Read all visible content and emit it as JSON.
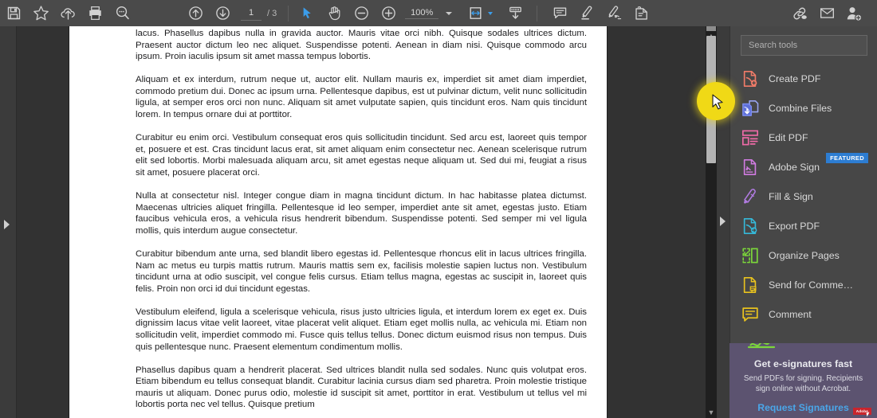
{
  "toolbar": {
    "left_tools": [
      {
        "name": "save-icon",
        "label": "Save"
      },
      {
        "name": "star-icon",
        "label": "Add to favorites"
      },
      {
        "name": "upload-cloud-icon",
        "label": "Upload to cloud"
      },
      {
        "name": "print-icon",
        "label": "Print file"
      },
      {
        "name": "search-icon",
        "label": "Find"
      }
    ],
    "nav_tools": [
      {
        "name": "previous-page-icon",
        "label": "Previous page"
      },
      {
        "name": "next-page-icon",
        "label": "Next page"
      }
    ],
    "page_current": "1",
    "page_separator": "/",
    "page_total": "3",
    "view_tools": [
      {
        "name": "select-cursor-icon",
        "label": "Select tool"
      },
      {
        "name": "hand-tool-icon",
        "label": "Hand tool"
      },
      {
        "name": "zoom-out-icon",
        "label": "Zoom out"
      },
      {
        "name": "zoom-in-icon",
        "label": "Zoom in"
      }
    ],
    "zoom_value": "100%",
    "fit_tools": [
      {
        "name": "fit-page-icon",
        "label": "Fit page"
      },
      {
        "name": "scroll-mode-icon",
        "label": "Page display"
      }
    ],
    "annot_tools": [
      {
        "name": "add-comment-icon",
        "label": "Add comment"
      },
      {
        "name": "highlight-text-icon",
        "label": "Highlight text"
      },
      {
        "name": "draw-freehand-icon",
        "label": "Draw free form"
      },
      {
        "name": "add-stamp-icon",
        "label": "Add stamp"
      }
    ],
    "share_tools": [
      {
        "name": "share-link-icon",
        "label": "Share a link"
      },
      {
        "name": "email-icon",
        "label": "Send by email"
      },
      {
        "name": "add-person-icon",
        "label": "Share with others"
      }
    ]
  },
  "search": {
    "placeholder": "Search tools",
    "value": ""
  },
  "tools": [
    {
      "label": "Create PDF",
      "icon": "create-pdf-icon",
      "color": "#f07b68"
    },
    {
      "label": "Combine Files",
      "icon": "combine-files-icon",
      "color": "#7b8cf0"
    },
    {
      "label": "Edit PDF",
      "icon": "edit-pdf-icon",
      "color": "#f06ba8"
    },
    {
      "label": "Adobe Sign",
      "icon": "adobe-sign-icon",
      "color": "#d07be0",
      "badge": "FEATURED"
    },
    {
      "label": "Fill & Sign",
      "icon": "fill-and-sign-icon",
      "color": "#b07be0"
    },
    {
      "label": "Export PDF",
      "icon": "export-pdf-icon",
      "color": "#35b8d8"
    },
    {
      "label": "Organize Pages",
      "icon": "organize-pages-icon",
      "color": "#7cd83a"
    },
    {
      "label": "Send for Comme…",
      "icon": "send-for-comments-icon",
      "color": "#e8c21e"
    },
    {
      "label": "Comment",
      "icon": "comment-icon",
      "color": "#e8c21e"
    }
  ],
  "promo": {
    "title": "Get e-signatures fast",
    "subtitle": "Send PDFs for signing. Recipients sign online without Acrobat.",
    "cta": "Request Signatures",
    "logo": "Adobe"
  },
  "document": {
    "paragraphs": [
      "lacus. Phasellus dapibus nulla in gravida auctor. Mauris vitae orci nibh. Quisque sodales ultrices dictum. Praesent auctor dictum leo nec aliquet. Suspendisse potenti. Aenean in diam nisi. Quisque commodo arcu ipsum. Proin iaculis ipsum sit amet massa tempus lobortis.",
      "Aliquam et ex interdum, rutrum neque ut, auctor elit. Nullam mauris ex, imperdiet sit amet diam imperdiet, commodo pretium dui. Donec ac ipsum urna. Pellentesque dapibus, est ut pulvinar dictum, velit nunc sollicitudin ligula, at semper eros orci non nunc. Aliquam sit amet vulputate sapien, quis tincidunt eros. Nam quis tincidunt lorem. In tempus ornare dui at porttitor.",
      "Curabitur eu enim orci. Vestibulum consequat eros quis sollicitudin tincidunt. Sed arcu est, laoreet quis tempor et, posuere et est. Cras tincidunt lacus erat, sit amet aliquam enim consectetur nec. Aenean scelerisque rutrum elit sed lobortis. Morbi malesuada aliquam arcu, sit amet egestas neque aliquam ut. Sed dui mi, feugiat a risus sit amet, posuere placerat orci.",
      "Nulla at consectetur nisl. Integer congue diam in magna tincidunt dictum. In hac habitasse platea dictumst. Maecenas ultricies aliquet fringilla. Pellentesque id leo semper, imperdiet ante sit amet, egestas justo. Etiam faucibus vehicula eros, a vehicula risus hendrerit bibendum. Suspendisse potenti. Sed semper mi vel ligula mollis, quis interdum augue consectetur.",
      "Curabitur bibendum ante urna, sed blandit libero egestas id. Pellentesque rhoncus elit in lacus ultrices fringilla. Nam ac metus eu turpis mattis rutrum. Mauris mattis sem ex, facilisis molestie sapien luctus non. Vestibulum tincidunt urna at odio suscipit, vel congue felis cursus. Etiam tellus magna, egestas ac suscipit in, laoreet quis felis. Proin non orci id dui tincidunt egestas.",
      "Vestibulum eleifend, ligula a scelerisque vehicula, risus justo ultricies ligula, et interdum lorem ex eget ex. Duis dignissim lacus vitae velit laoreet, vitae placerat velit aliquet. Etiam eget mollis nulla, ac vehicula mi. Etiam non sollicitudin velit, imperdiet commodo mi. Fusce quis tellus tellus. Donec dictum euismod risus non tempus. Duis quis pellentesque nunc. Praesent elementum condimentum mollis.",
      "Phasellus dapibus quam a hendrerit placerat. Sed ultrices blandit nulla sed sodales. Nunc quis volutpat eros. Etiam bibendum eu tellus consequat blandit. Curabitur lacinia cursus diam sed pharetra. Proin molestie tristique mauris ut aliquam. Donec purus odio, molestie id suscipit sit amet, porttitor in erat. Vestibulum ut tellus vel mi lobortis porta nec vel tellus. Quisque pretium"
    ]
  },
  "colors": {
    "toolbar_bg": "#4a4a4a",
    "panel_bg": "#474747",
    "doc_bg": "#323232",
    "accent_blue": "#3b9dea",
    "badge_blue": "#2d7dd2",
    "promo_bg": "#5c5370",
    "cursor_highlight": "#f0d916"
  }
}
